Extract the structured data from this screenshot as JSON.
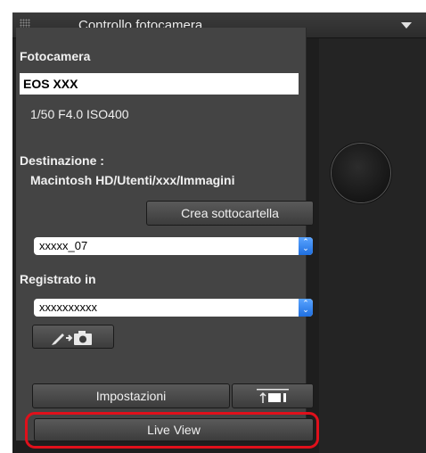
{
  "window": {
    "title": "Controllo fotocamera"
  },
  "camera": {
    "section_label": "Fotocamera",
    "name": "EOS XXX",
    "settings": "1/50  F4.0  ISO400"
  },
  "destination": {
    "label": "Destinazione :",
    "path": "Macintosh HD/Utenti/xxx/Immagini",
    "create_subfolder_label": "Crea sottocartella",
    "subfolder_value": "xxxxx_07"
  },
  "recorded_in": {
    "label": "Registrato in",
    "value": "xxxxxxxxxx"
  },
  "tools": {
    "settings_label": "Impostazioni",
    "live_view_label": "Live View"
  },
  "colors": {
    "panel": "#444444",
    "select_accent": "#2f7bea",
    "highlight": "#e0101b"
  },
  "icons": [
    "grip-icon",
    "menu-arrow-icon",
    "pen-to-camera-icon",
    "upload-display-icon",
    "select-arrows-icon"
  ]
}
